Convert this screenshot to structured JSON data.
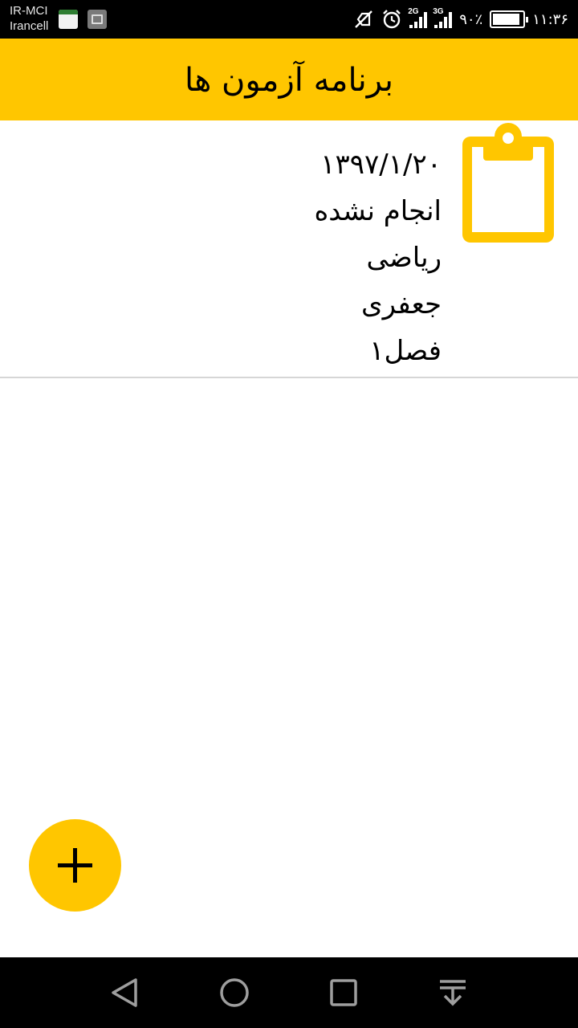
{
  "status_bar": {
    "carrier_1": "IR-MCI",
    "carrier_2": "Irancell",
    "sim1_network": "2G",
    "sim2_network": "3G",
    "battery_percent": "۹۰٪",
    "battery_level": 0.9,
    "time": "۱۱:۳۶",
    "icons": [
      "notification-app-icon",
      "notification-gallery-icon",
      "vibrate-off-icon",
      "alarm-icon",
      "signal-icon",
      "signal-icon",
      "battery-icon"
    ]
  },
  "app_bar": {
    "title": "برنامه آزمون ها"
  },
  "exams": [
    {
      "date": "۱۳۹۷/۱/۲۰",
      "status": "انجام نشده",
      "subject": "ریاضی",
      "teacher": "جعفری",
      "chapter": "فصل۱",
      "icon": "clipboard-icon"
    }
  ],
  "fab": {
    "icon": "plus-icon"
  },
  "navigation_bar": {
    "icons": [
      "back-icon",
      "home-icon",
      "recents-icon",
      "notification-pull-icon"
    ]
  },
  "colors": {
    "accent": "#ffc600",
    "status_bar": "#000000",
    "nav_bar": "#000000",
    "divider": "#d6d6d6"
  }
}
